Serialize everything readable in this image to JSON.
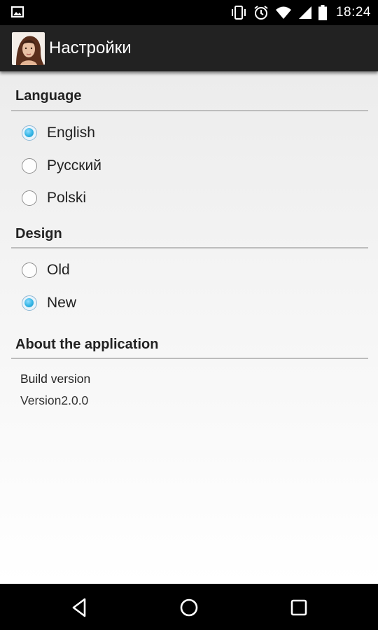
{
  "status_bar": {
    "time": "18:24",
    "icons": [
      "image-notification-icon",
      "vibrate-icon",
      "alarm-icon",
      "wifi-icon",
      "signal-icon",
      "battery-icon"
    ]
  },
  "action_bar": {
    "title": "Настройки",
    "icon": "app-avatar-icon"
  },
  "settings": {
    "language": {
      "title": "Language",
      "options": [
        {
          "label": "English",
          "checked": true
        },
        {
          "label": "Русский",
          "checked": false
        },
        {
          "label": "Polski",
          "checked": false
        }
      ]
    },
    "design": {
      "title": "Design",
      "options": [
        {
          "label": "Old",
          "checked": false
        },
        {
          "label": "New",
          "checked": true
        }
      ]
    },
    "about": {
      "title": "About the application",
      "item_title": "Build version",
      "item_value": "Version2.0.0"
    }
  },
  "nav_bar": {
    "buttons": [
      "back-icon",
      "home-icon",
      "recents-icon"
    ]
  },
  "colors": {
    "accent": "#33b5e5",
    "action_bar": "#222222",
    "divider": "#bdbdbd"
  }
}
